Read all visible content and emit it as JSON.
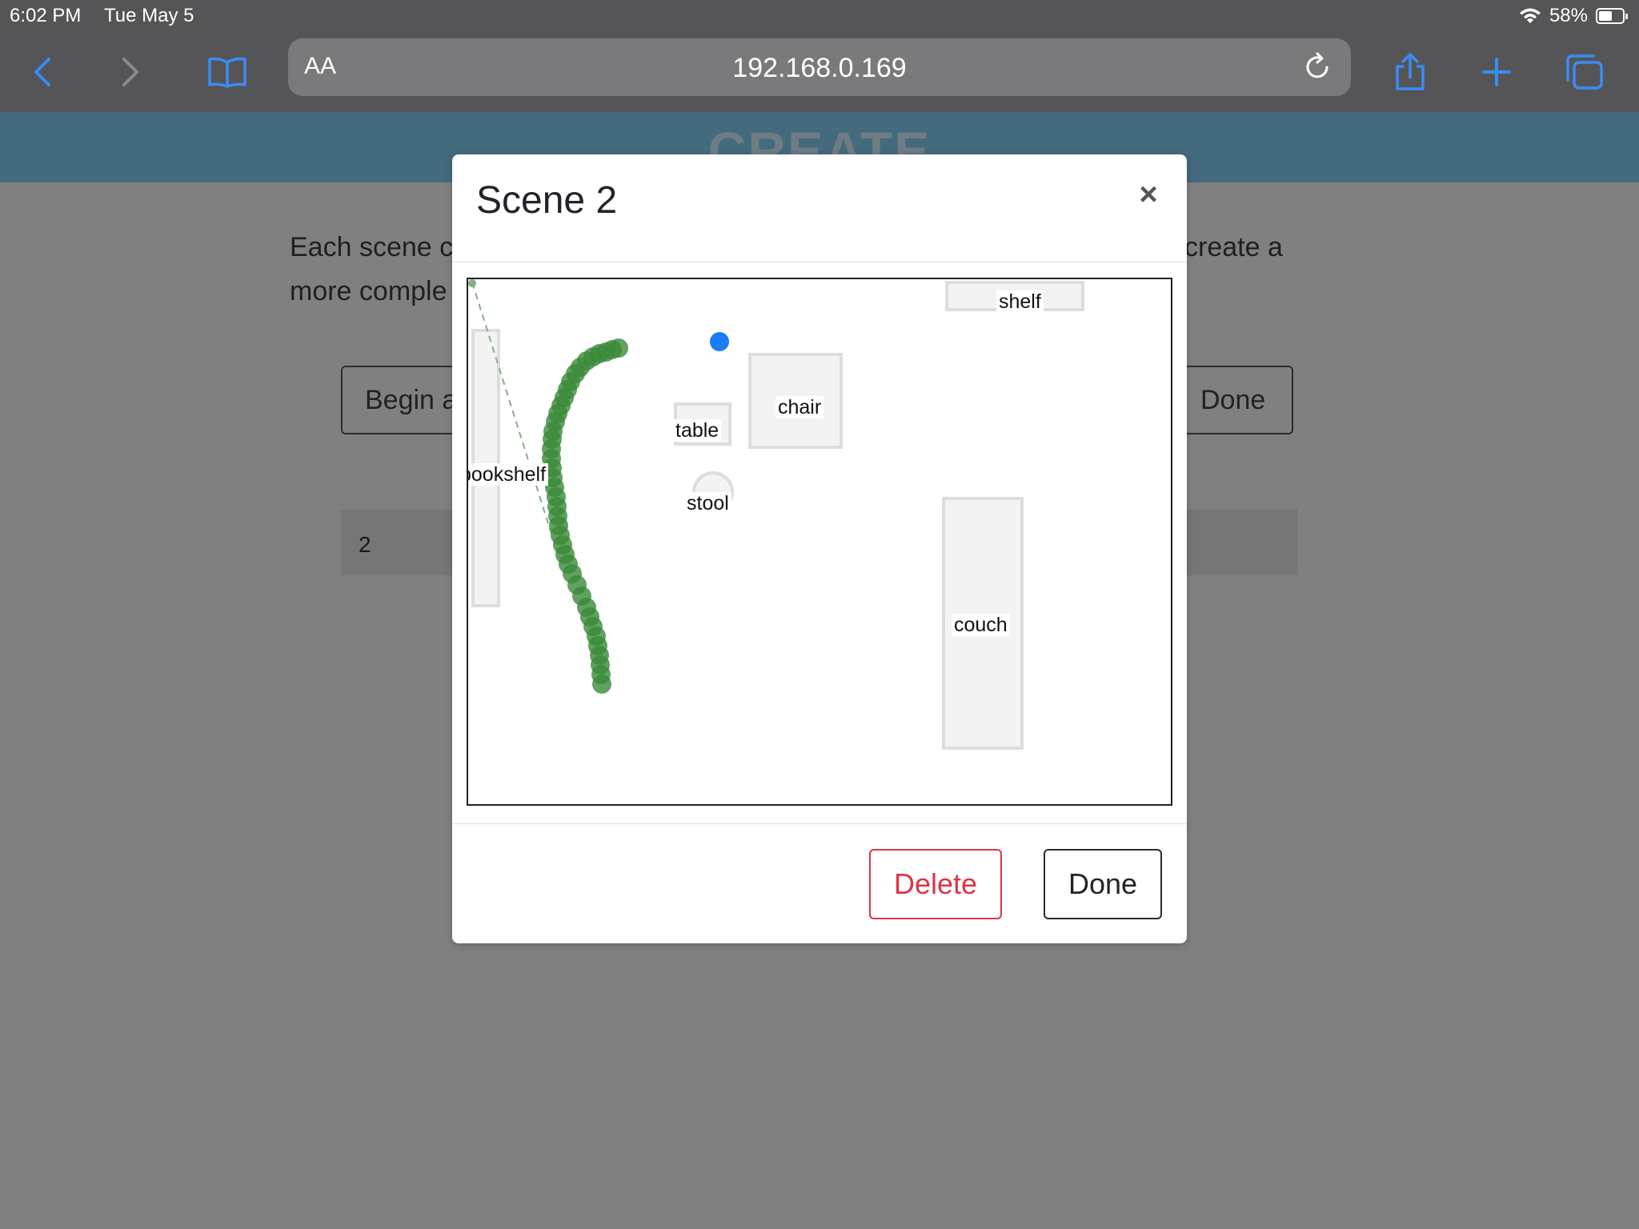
{
  "status_bar": {
    "time": "6:02 PM",
    "date": "Tue May 5",
    "battery": "58%",
    "battery_level": 0.58
  },
  "browser": {
    "text_size_label": "AA",
    "url": "192.168.0.169",
    "icons": [
      "back-icon",
      "forward-icon",
      "bookmarks-icon",
      "reload-icon",
      "share-icon",
      "new-tab-icon",
      "tabs-icon"
    ]
  },
  "page": {
    "header_title": "CREATE",
    "intro_line1_start": "Each scene c",
    "intro_line1_end": "create a",
    "intro_line2_start": "more comple",
    "begin_button": "Begin a",
    "done_button": "Done",
    "scene_row_value": "2"
  },
  "modal": {
    "title": "Scene 2",
    "close": "×",
    "delete_label": "Delete",
    "done_label": "Done",
    "objects": {
      "shelf": "shelf",
      "chair": "chair",
      "table": "table",
      "bookshelf": "bookshelf",
      "stool": "stool",
      "couch": "couch"
    },
    "colors": {
      "path": "#3a8a3a",
      "marker": "#1a7ef7",
      "delete": "#dc3545"
    }
  }
}
